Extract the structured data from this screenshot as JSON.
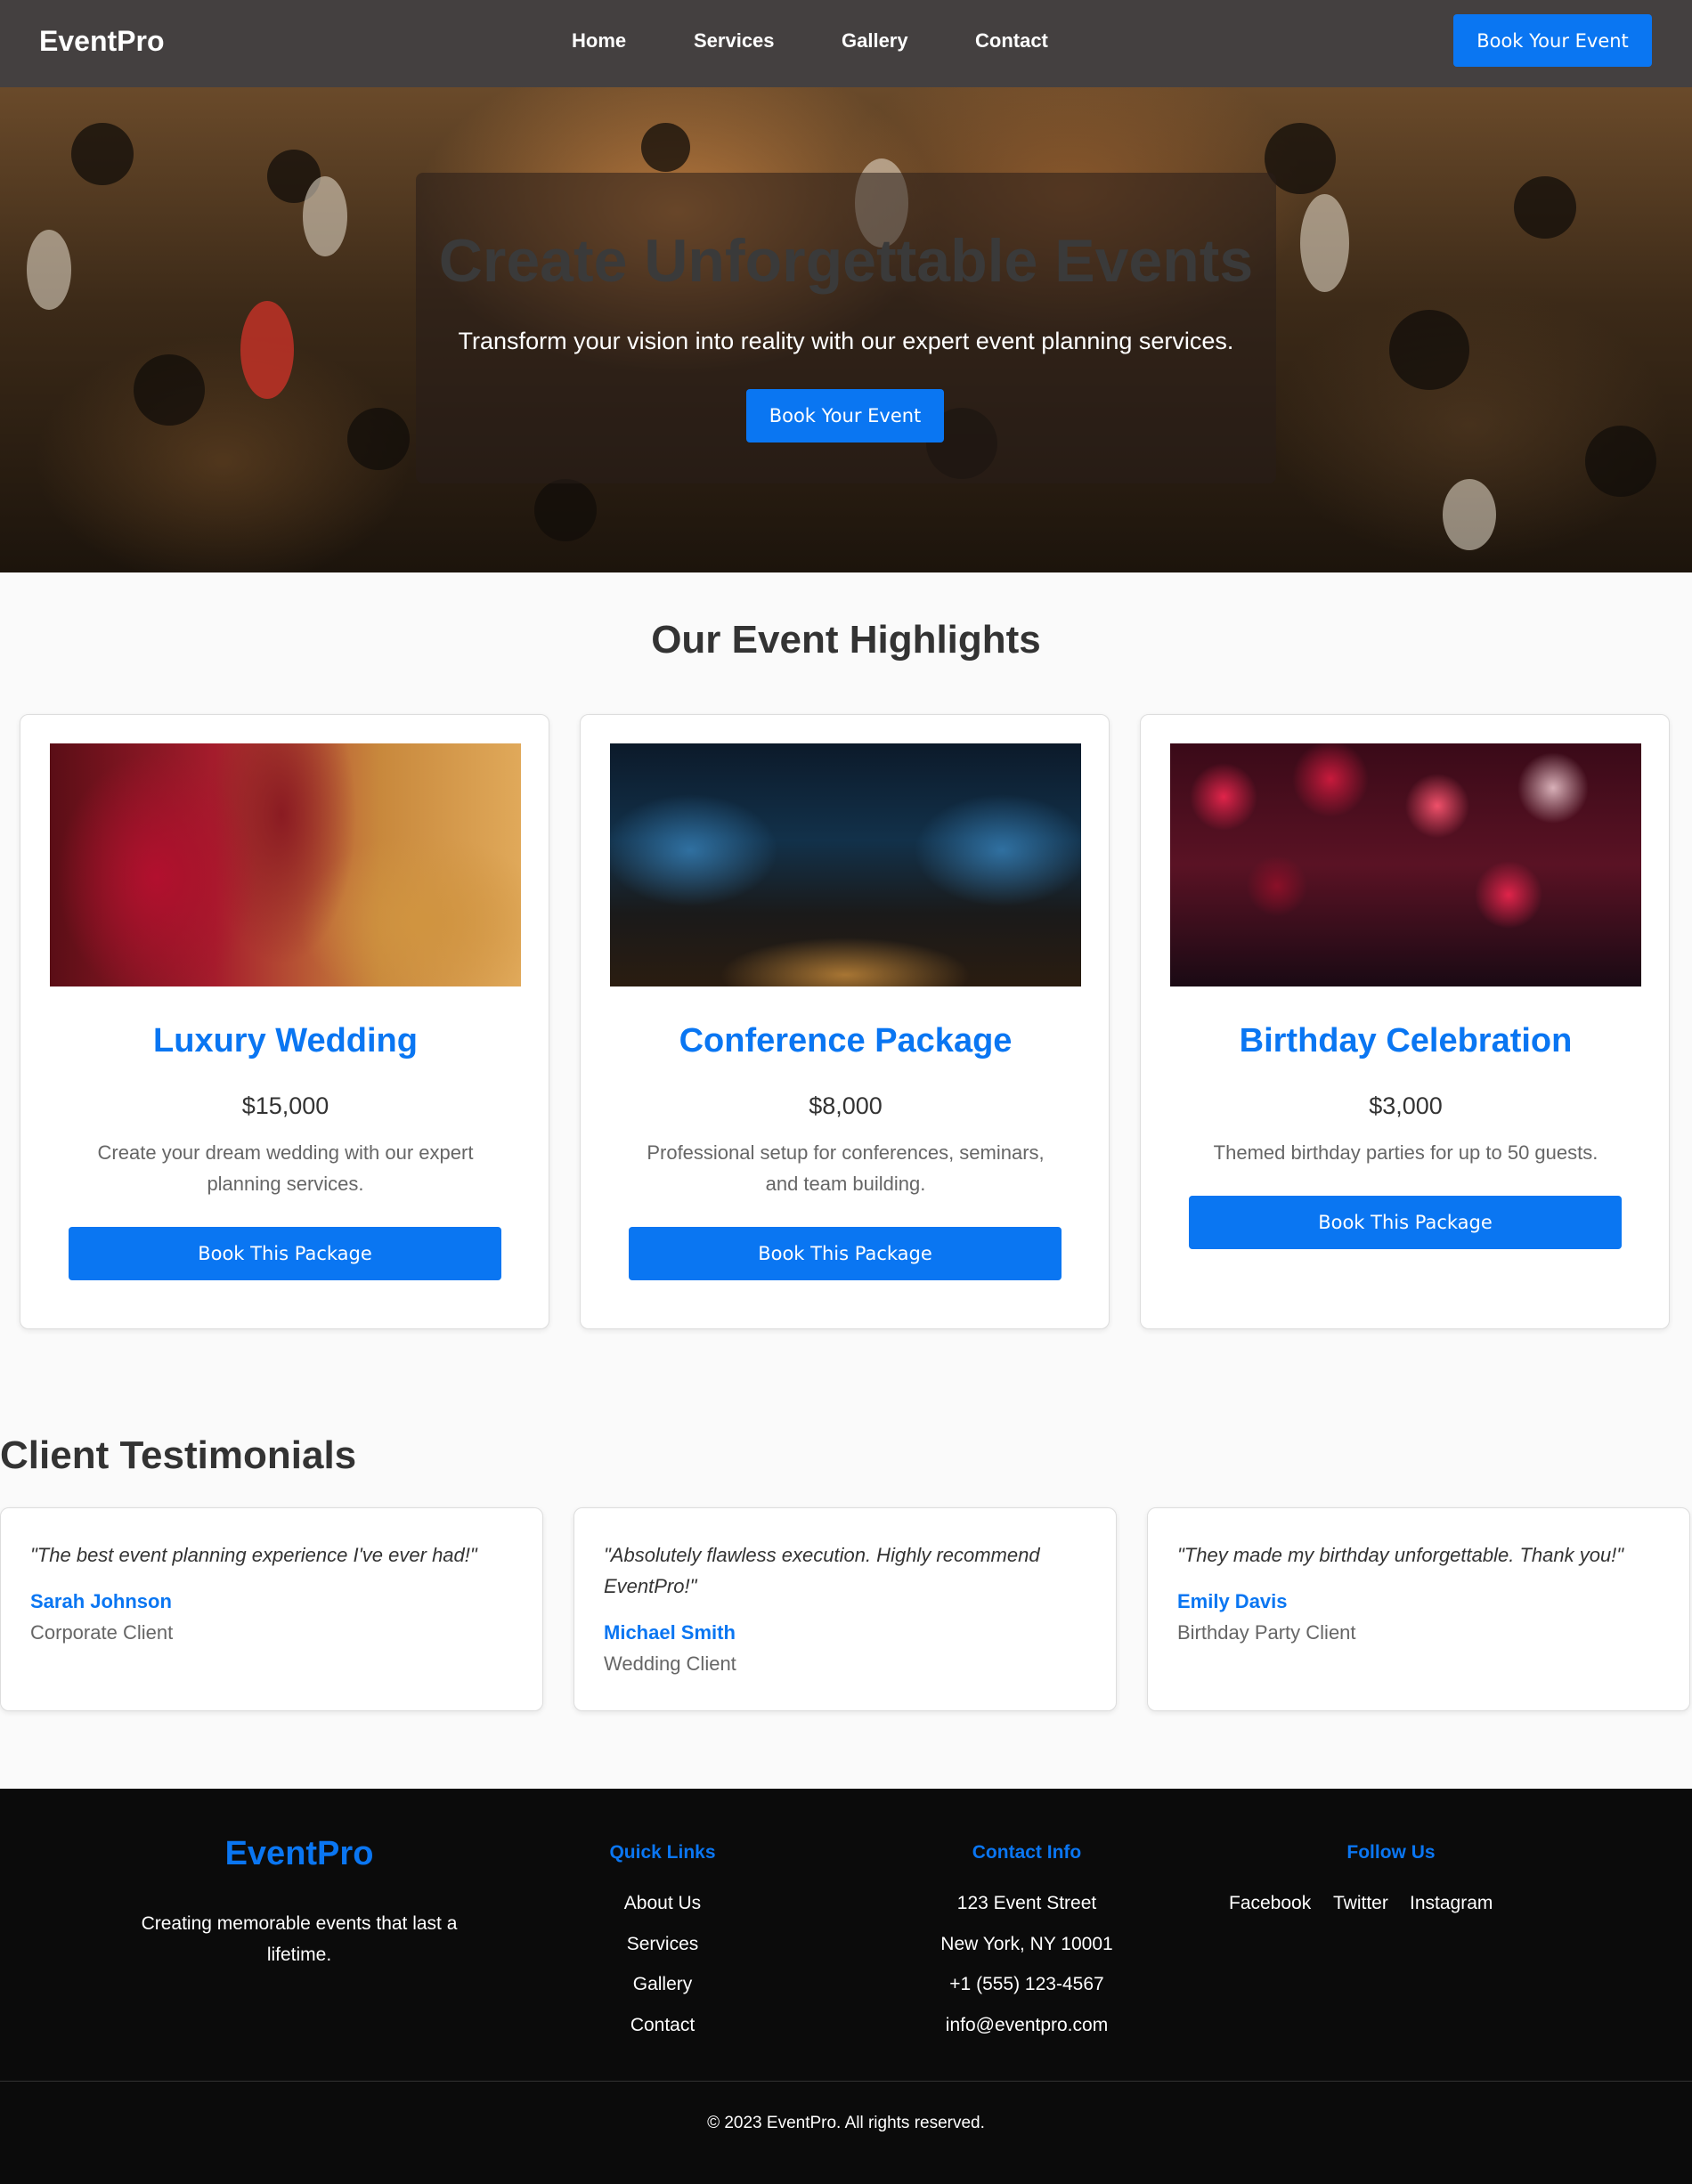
{
  "nav": {
    "logo": "EventPro",
    "links": [
      "Home",
      "Services",
      "Gallery",
      "Contact"
    ],
    "cta": "Book Your Event"
  },
  "hero": {
    "title": "Create Unforgettable Events",
    "subtitle": "Transform your vision into reality with our expert event planning services.",
    "cta": "Book Your Event"
  },
  "highlights": {
    "title": "Our Event Highlights",
    "cards": [
      {
        "title": "Luxury Wedding",
        "price": "$15,000",
        "desc": "Create your dream wedding with our expert planning services.",
        "button": "Book This Package"
      },
      {
        "title": "Conference Package",
        "price": "$8,000",
        "desc": "Professional setup for conferences, seminars, and team building.",
        "button": "Book This Package"
      },
      {
        "title": "Birthday Celebration",
        "price": "$3,000",
        "desc": "Themed birthday parties for up to 50 guests.",
        "button": "Book This Package"
      }
    ]
  },
  "testimonials": {
    "title": "Client Testimonials",
    "items": [
      {
        "quote": "\"The best event planning experience I've ever had!\"",
        "name": "Sarah Johnson",
        "role": "Corporate Client"
      },
      {
        "quote": "\"Absolutely flawless execution. Highly recommend EventPro!\"",
        "name": "Michael Smith",
        "role": "Wedding Client"
      },
      {
        "quote": "\"They made my birthday unforgettable. Thank you!\"",
        "name": "Emily Davis",
        "role": "Birthday Party Client"
      }
    ]
  },
  "footer": {
    "logo": "EventPro",
    "tagline": "Creating memorable events that last a lifetime.",
    "quick_links": {
      "title": "Quick Links",
      "items": [
        "About Us",
        "Services",
        "Gallery",
        "Contact"
      ]
    },
    "contact": {
      "title": "Contact Info",
      "items": [
        "123 Event Street",
        "New York, NY 10001",
        "+1 (555) 123-4567",
        "info@eventpro.com"
      ]
    },
    "follow": {
      "title": "Follow Us",
      "items": [
        "Facebook",
        "Twitter",
        "Instagram"
      ]
    },
    "copyright": "© 2023 EventPro. All rights reserved."
  },
  "colors": {
    "accent": "#0a76f2",
    "nav_bg": "#444040",
    "footer_bg": "#0b0b0b"
  }
}
